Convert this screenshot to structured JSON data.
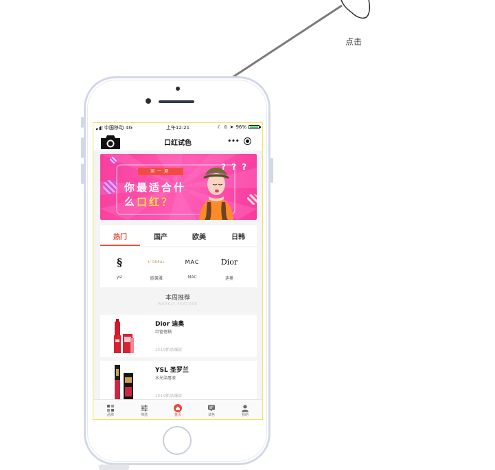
{
  "annotation": {
    "tap_label": "点击"
  },
  "status_bar": {
    "carrier": "中国移动",
    "network": "4G",
    "time": "上午12:21",
    "battery": "96%"
  },
  "nav": {
    "title": "口红试色",
    "more": "•••"
  },
  "banner": {
    "tag": "测一测",
    "line1": "你最适合什",
    "line2_prefix": "么",
    "line2_highlight": "口红？",
    "question_marks": "? ? ?"
  },
  "categories": [
    {
      "label": "热门",
      "active": true
    },
    {
      "label": "国产",
      "active": false
    },
    {
      "label": "欧美",
      "active": false
    },
    {
      "label": "日韩",
      "active": false
    }
  ],
  "brands": [
    {
      "logo": "YSL",
      "name": "ysl"
    },
    {
      "logo": "L'OREAL",
      "name": "欧莱雅"
    },
    {
      "logo": "MAC",
      "name": "MAC"
    },
    {
      "logo": "Dior",
      "name": "迪奥"
    }
  ],
  "weekly": {
    "title": "本周推荐",
    "subtitle": "WEEKLY FEATURE"
  },
  "products": [
    {
      "name": "Dior 迪奥",
      "sub": "红管蓓釉",
      "meta": "2019新品爆款"
    },
    {
      "name": "YSL 圣罗兰",
      "sub": "水光染唇液",
      "meta": "2019新品爆款"
    }
  ],
  "tabbar": [
    {
      "label": "品牌",
      "active": false
    },
    {
      "label": "筛选",
      "active": false
    },
    {
      "label": "首页",
      "active": true
    },
    {
      "label": "试色",
      "active": false
    },
    {
      "label": "我的",
      "active": false
    }
  ],
  "colors": {
    "accent": "#e74c3c",
    "banner_pink": "#f73e9c",
    "highlight_yellow": "#ffe337",
    "screen_border": "#f2e35f"
  }
}
